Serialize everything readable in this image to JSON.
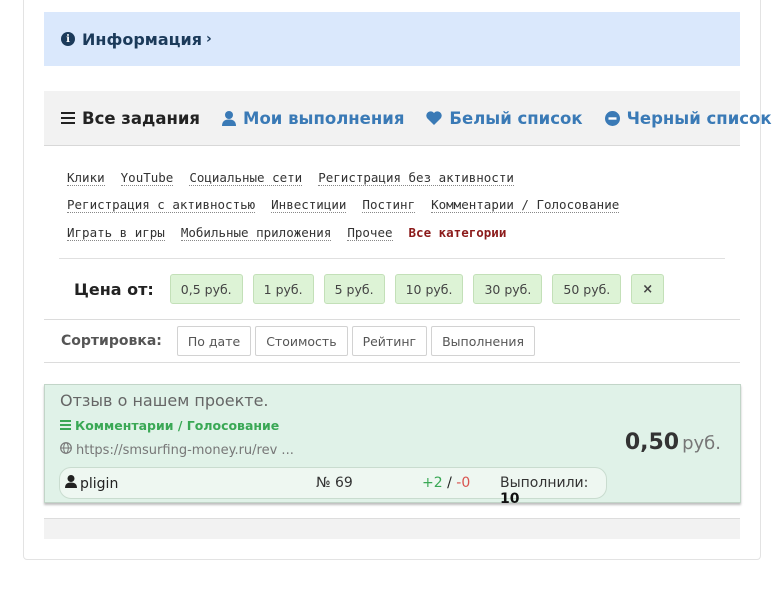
{
  "info": {
    "label": "Информация"
  },
  "tabs": [
    {
      "label": "Все задания",
      "icon": "bars-icon"
    },
    {
      "label": "Мои выполнения",
      "icon": "user-icon"
    },
    {
      "label": "Белый список",
      "icon": "heart-icon"
    },
    {
      "label": "Черный список",
      "icon": "minus-circle-icon"
    }
  ],
  "categories": {
    "row1": [
      "Клики",
      "YouTube",
      "Социальные сети",
      "Регистрация без активности"
    ],
    "row2": [
      "Регистрация с активностью",
      "Инвестиции",
      "Постинг",
      "Комментарии / Голосование"
    ],
    "row3": [
      "Играть в игры",
      "Мобильные приложения",
      "Прочее"
    ],
    "all": "Все категории"
  },
  "price_filter": {
    "label": "Цена от:",
    "options": [
      "0,5 руб.",
      "1 руб.",
      "5 руб.",
      "10 руб.",
      "30 руб.",
      "50 руб."
    ],
    "clear": "×"
  },
  "sort": {
    "label": "Сортировка:",
    "options": [
      "По дате",
      "Стоимость",
      "Рейтинг",
      "Выполнения"
    ]
  },
  "task": {
    "title": "Отзыв о нашем проекте.",
    "category": "Комментарии / Голосование",
    "url": "https://smsurfing-money.ru/rev ...",
    "price": "0,50",
    "currency": "руб.",
    "user": "pligin",
    "number": "№ 69",
    "votes_plus": "+2",
    "votes_sep": " / ",
    "votes_minus": "-0",
    "done_label": "Выполнили:",
    "done_count": "10"
  },
  "colors": {
    "info_bg": "#dae8fc",
    "link": "#3a7ab6",
    "task_bg": "#e0f2e8",
    "price_btn_bg": "#ddf3d6",
    "category_green": "#3aa855",
    "all_categories": "#8b1a1a"
  }
}
